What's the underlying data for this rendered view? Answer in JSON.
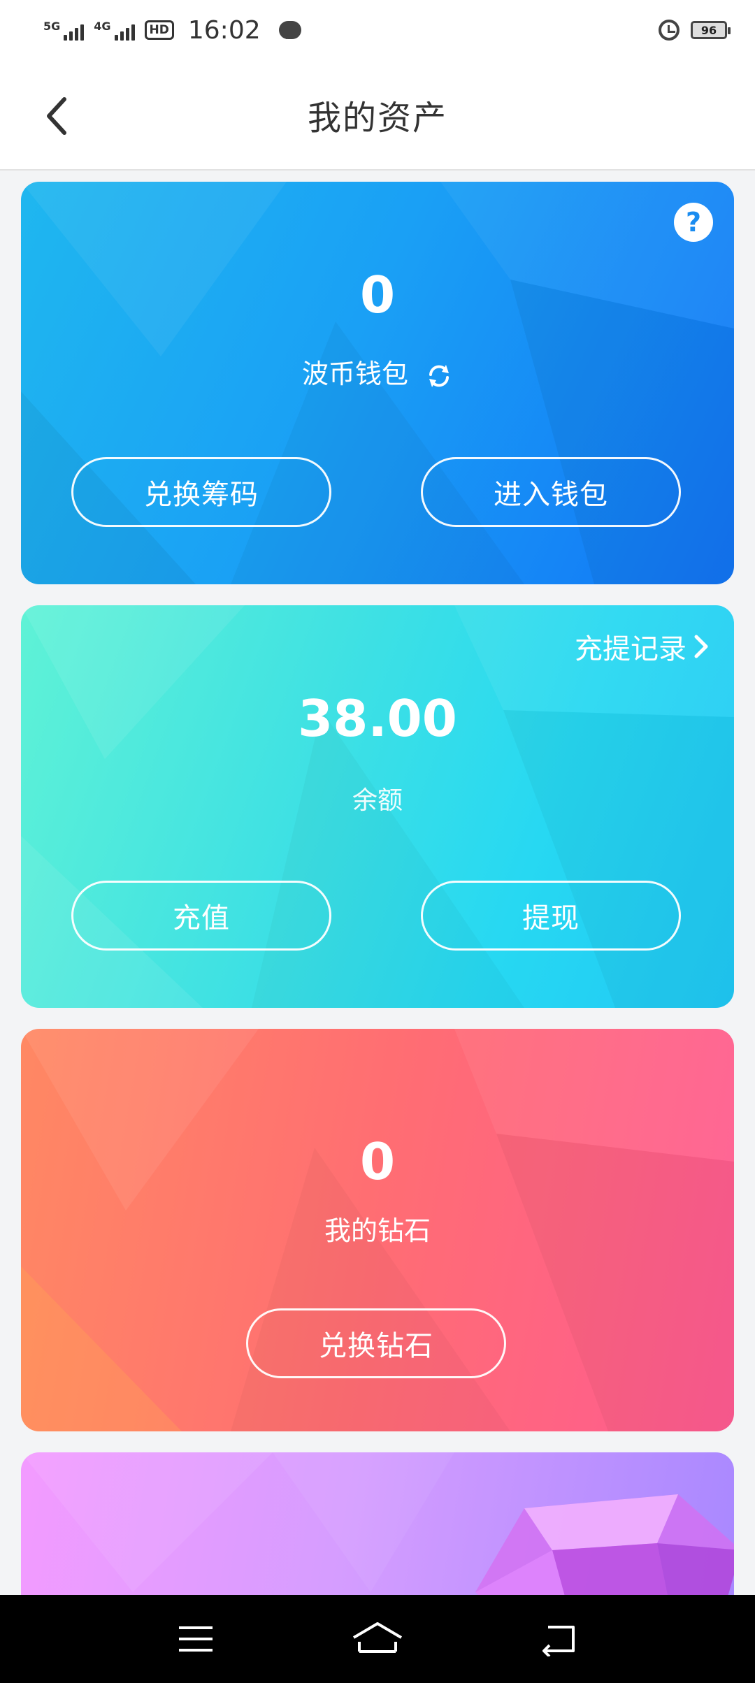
{
  "status_bar": {
    "signal_1_label": "5G",
    "signal_2_label": "4G",
    "hd_label": "HD",
    "time": "16:02",
    "battery_level": "96"
  },
  "header": {
    "title": "我的资产"
  },
  "wallet_card": {
    "amount": "0",
    "label": "波币钱包",
    "buttons": {
      "exchange_chips": "兑换筹码",
      "enter_wallet": "进入钱包"
    },
    "colors": {
      "start": "#1fb7ef",
      "end": "#1275f6"
    }
  },
  "balance_card": {
    "records_link": "充提记录",
    "amount": "38.00",
    "label": "余额",
    "buttons": {
      "recharge": "充值",
      "withdraw": "提现"
    },
    "colors": {
      "start": "#5ff2d6",
      "end": "#20c8f5"
    }
  },
  "diamond_card": {
    "amount": "0",
    "label": "我的钻石",
    "buttons": {
      "exchange_diamond": "兑换钻石"
    },
    "colors": {
      "start": "#ff8863",
      "end": "#ff5b92"
    }
  },
  "icons": {
    "back": "chevron-left-icon",
    "help": "question-icon",
    "sync": "refresh-icon",
    "records": "chevron-right-icon",
    "nav_menu": "menu-icon",
    "nav_home": "home-icon",
    "nav_back": "back-icon"
  }
}
